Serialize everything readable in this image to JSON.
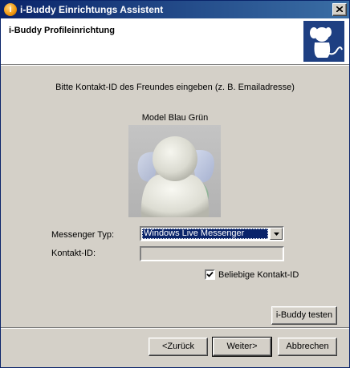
{
  "window": {
    "title": "i-Buddy Einrichtungs Assistent",
    "app_icon_glyph": "i"
  },
  "header": {
    "title": "i-Buddy Profileinrichtung",
    "logo_icon": "i-buddy-logo"
  },
  "main": {
    "instruction": "Bitte Kontakt-ID des Freundes eingeben (z. B. Emailadresse)",
    "model_label": "Model Blau Grün",
    "messenger_label": "Messenger Typ:",
    "messenger_value": "Windows Live Messenger",
    "contact_label": "Kontakt-ID:",
    "contact_value": "",
    "any_contact_label": "Beliebige Kontakt-ID",
    "any_contact_checked": true,
    "test_button": "i-Buddy testen"
  },
  "footer": {
    "back_button": "<Zurück",
    "next_button": "Weiter>",
    "cancel_button": "Abbrechen"
  },
  "colors": {
    "titlebar_start": "#0a246a",
    "titlebar_end": "#3a6ea5",
    "face": "#d4d0c8",
    "logo_bg": "#1e3f82",
    "selection": "#0a246a"
  }
}
